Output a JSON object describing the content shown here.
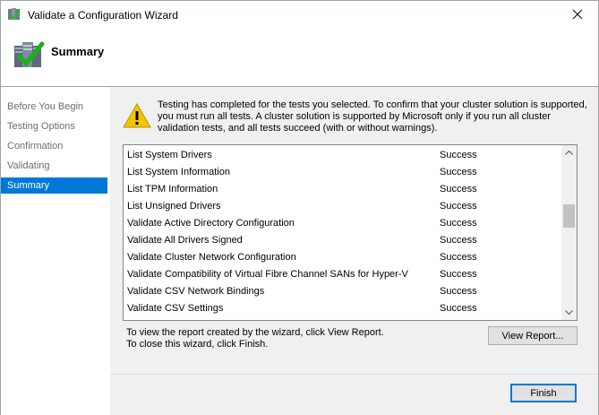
{
  "window": {
    "title": "Validate a Configuration Wizard"
  },
  "header": {
    "title": "Summary"
  },
  "nav": {
    "items": [
      {
        "label": "Before You Begin",
        "active": false
      },
      {
        "label": "Testing Options",
        "active": false
      },
      {
        "label": "Confirmation",
        "active": false
      },
      {
        "label": "Validating",
        "active": false
      },
      {
        "label": "Summary",
        "active": true
      }
    ]
  },
  "main": {
    "info_text": "Testing has completed for the tests you selected. To confirm that your cluster solution is supported, you must run all tests.  A cluster solution is supported by Microsoft only if you run all cluster validation tests, and all tests succeed (with or without warnings).",
    "results": [
      {
        "name": "List System Drivers",
        "status": "Success"
      },
      {
        "name": "List System Information",
        "status": "Success"
      },
      {
        "name": "List TPM Information",
        "status": "Success"
      },
      {
        "name": "List Unsigned Drivers",
        "status": "Success"
      },
      {
        "name": "Validate Active Directory Configuration",
        "status": "Success"
      },
      {
        "name": "Validate All Drivers Signed",
        "status": "Success"
      },
      {
        "name": "Validate Cluster Network Configuration",
        "status": "Success"
      },
      {
        "name": "Validate Compatibility of Virtual Fibre Channel SANs for Hyper-V",
        "status": "Success"
      },
      {
        "name": "Validate CSV Network Bindings",
        "status": "Success"
      },
      {
        "name": "Validate CSV Settings",
        "status": "Success"
      }
    ],
    "report_hint": "To view the report created by the wizard, click View Report.",
    "close_hint": "To close this wizard, click Finish.",
    "view_report_label": "View Report...",
    "finish_label": "Finish"
  },
  "colors": {
    "accent": "#0078d7",
    "panel": "#f0f0f0"
  }
}
